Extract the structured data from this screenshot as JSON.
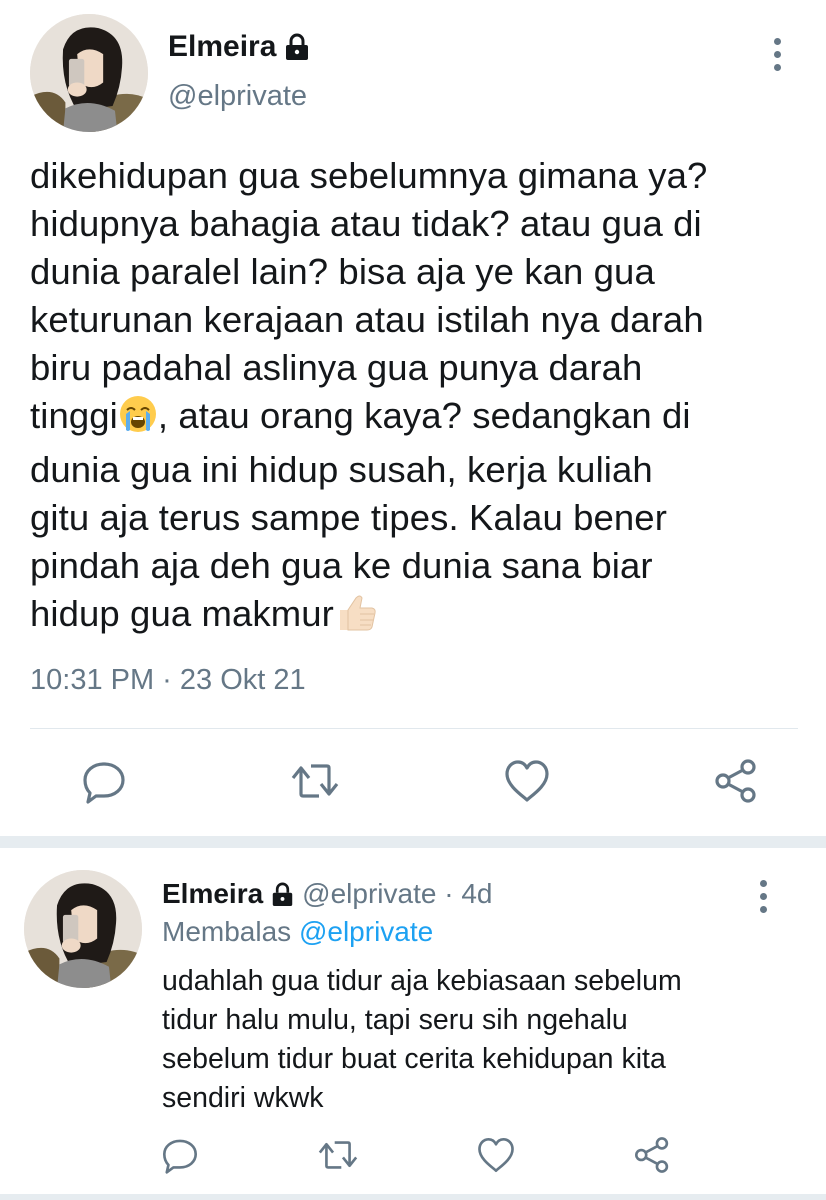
{
  "main_tweet": {
    "avatar": "avatar-photo",
    "display_name": "Elmeira",
    "lock_icon": "lock-icon",
    "handle": "@elprivate",
    "more_icon": "more-vertical-icon",
    "text_lines": [
      "dikehidupan gua sebelumnya gimana ya?",
      "hidupnya bahagia atau tidak? atau gua di",
      "dunia paralel lain? bisa aja ye kan gua",
      "keturunan kerajaan atau istilah nya darah",
      "biru padahal aslinya gua punya darah",
      "tinggi",
      ", atau orang kaya? sedangkan di",
      "dunia gua ini hidup susah, kerja kuliah",
      "gitu aja terus sampe tipes. Kalau bener",
      "pindah aja deh gua ke dunia sana biar",
      "hidup gua makmur"
    ],
    "emojis": [
      "loudly-crying-face-emoji",
      "thumbs-up-emoji"
    ],
    "timestamp": "10:31 PM · 23 Okt 21",
    "actions": [
      "reply-icon",
      "retweet-icon",
      "like-icon",
      "share-icon"
    ]
  },
  "reply_tweet": {
    "avatar": "avatar-photo",
    "display_name": "Elmeira",
    "lock_icon": "lock-icon",
    "handle_time": "@elprivate · 4d",
    "replying_to_label": "Membalas",
    "replying_to_handle": "@elprivate",
    "more_icon": "more-vertical-icon",
    "text_lines": [
      "udahlah gua tidur aja kebiasaan sebelum",
      "tidur halu mulu, tapi seru sih ngehalu",
      "sebelum tidur buat cerita kehidupan kita",
      "sendiri wkwk"
    ],
    "actions": [
      "reply-icon",
      "retweet-icon",
      "like-icon",
      "share-icon"
    ]
  },
  "colors": {
    "text": "#14171a",
    "secondary": "#657786",
    "link": "#1da1f2",
    "divider": "#e1e8ed",
    "separator": "#e6ecf0"
  }
}
